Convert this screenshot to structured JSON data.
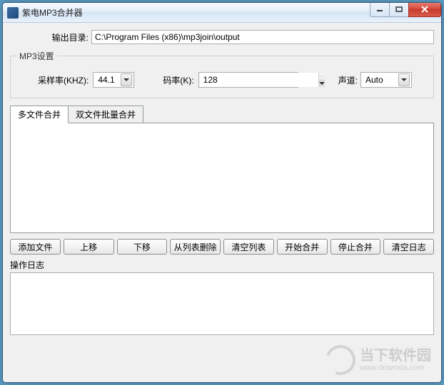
{
  "window": {
    "title": "紫电MP3合并器"
  },
  "output": {
    "label": "输出目录:",
    "value": "C:\\Program Files (x86)\\mp3join\\output"
  },
  "mp3settings": {
    "legend": "MP3设置",
    "samplerate_label": "采样率(KHZ):",
    "samplerate_value": "44.1",
    "bitrate_label": "码率(K):",
    "bitrate_value": "128",
    "channel_label": "声道:",
    "channel_value": "Auto"
  },
  "tabs": {
    "multi": "多文件合并",
    "dual": "双文件批量合并"
  },
  "buttons": {
    "add": "添加文件",
    "up": "上移",
    "down": "下移",
    "remove": "从列表删除",
    "clearlist": "清空列表",
    "start": "开始合并",
    "stop": "停止合并",
    "clearlog": "清空日志"
  },
  "log": {
    "label": "操作日志",
    "content": ""
  },
  "watermark": {
    "name": "当下软件园",
    "url": "www.downxia.com"
  }
}
